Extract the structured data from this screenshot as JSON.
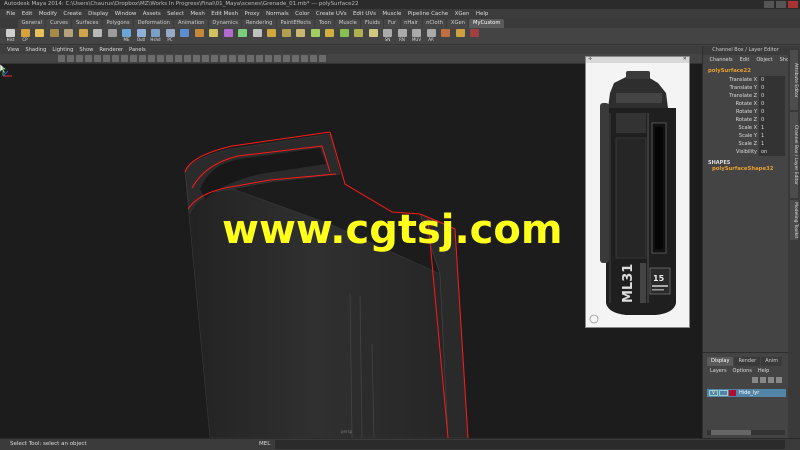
{
  "window": {
    "title": "Autodesk Maya 2014: C:\\Users\\Chaurus\\Dropbox\\MZ\\Works In Progress\\Final\\01_Maya\\scenes\\Grenade_01.mb* --- polySurface22"
  },
  "menu": [
    "File",
    "Edit",
    "Modify",
    "Create",
    "Display",
    "Window",
    "Assets",
    "Select",
    "Mesh",
    "Edit Mesh",
    "Proxy",
    "Normals",
    "Color",
    "Create UVs",
    "Edit UVs",
    "Muscle",
    "Pipeline Cache",
    "XGen",
    "Help"
  ],
  "shelf_tabs": {
    "items": [
      "General",
      "Curves",
      "Surfaces",
      "Polygons",
      "Deformation",
      "Animation",
      "Dynamics",
      "Rendering",
      "PaintEffects",
      "Toon",
      "Muscle",
      "Fluids",
      "Fur",
      "nHair",
      "nCloth",
      "XGen",
      "MyCustom"
    ],
    "active": "MyCustom"
  },
  "shelf_buttons": [
    {
      "label": "Hist",
      "color": "#cfcfcf"
    },
    {
      "label": "CP",
      "color": "#d7a23a"
    },
    {
      "label": "",
      "color": "#e8c05a"
    },
    {
      "label": "",
      "color": "#a58a4a"
    },
    {
      "label": "",
      "color": "#b5a27a"
    },
    {
      "label": "",
      "color": "#cfa64a"
    },
    {
      "label": "",
      "color": "#b8b8b8"
    },
    {
      "label": "",
      "color": "#9c9c9c"
    },
    {
      "label": "ME",
      "color": "#6aa6d8"
    },
    {
      "label": "Outl",
      "color": "#8fb0d8"
    },
    {
      "label": "Hshd",
      "color": "#7aa0c8"
    },
    {
      "label": "PC",
      "color": "#9aa8c8"
    },
    {
      "label": "",
      "color": "#5a8ed0"
    },
    {
      "label": "",
      "color": "#c48a3a"
    },
    {
      "label": "",
      "color": "#d0c060"
    },
    {
      "label": "",
      "color": "#b06ad0"
    },
    {
      "label": "",
      "color": "#7ad07a"
    },
    {
      "label": "",
      "color": "#c0c0c0"
    },
    {
      "label": "",
      "color": "#d0a840"
    },
    {
      "label": "",
      "color": "#b0a050"
    },
    {
      "label": "",
      "color": "#c8b870"
    },
    {
      "label": "",
      "color": "#a0d060"
    },
    {
      "label": "",
      "color": "#d0b040"
    },
    {
      "label": "",
      "color": "#88c050"
    },
    {
      "label": "",
      "color": "#b0b050"
    },
    {
      "label": "",
      "color": "#d0c880"
    },
    {
      "label": "SN",
      "color": "#aaaaaa"
    },
    {
      "label": "RN",
      "color": "#aaaaaa"
    },
    {
      "label": "MUV",
      "color": "#aaaaaa"
    },
    {
      "label": "AR",
      "color": "#aaaaaa"
    },
    {
      "label": "",
      "color": "#c07040"
    },
    {
      "label": "",
      "color": "#d0a040"
    },
    {
      "label": "",
      "color": "#a04040"
    }
  ],
  "panel_menu": [
    "View",
    "Shading",
    "Lighting",
    "Show",
    "Renderer",
    "Panels"
  ],
  "viewport": {
    "watermark": "www.cgtsj.com",
    "camera_label": "persp"
  },
  "channel_box": {
    "title": "Channel Box / Layer Editor",
    "menu": [
      "Channels",
      "Edit",
      "Object",
      "Show"
    ],
    "object_name": "polySurface22",
    "attributes": [
      {
        "name": "Translate X",
        "value": "0"
      },
      {
        "name": "Translate Y",
        "value": "0"
      },
      {
        "name": "Translate Z",
        "value": "0"
      },
      {
        "name": "Rotate X",
        "value": "0"
      },
      {
        "name": "Rotate Y",
        "value": "0"
      },
      {
        "name": "Rotate Z",
        "value": "0"
      },
      {
        "name": "Scale X",
        "value": "1"
      },
      {
        "name": "Scale Y",
        "value": "1"
      },
      {
        "name": "Scale Z",
        "value": "1"
      },
      {
        "name": "Visibility",
        "value": "on"
      }
    ],
    "shapes_header": "SHAPES",
    "shape_name": "polySurfaceShape32"
  },
  "side_tabs": [
    "Attribute Editor",
    "Channel Box / Layer Editor",
    "Modeling Toolkit"
  ],
  "layer_editor": {
    "tabs": [
      "Display",
      "Render",
      "Anim"
    ],
    "active_tab": "Display",
    "menu": [
      "Layers",
      "Options",
      "Help"
    ],
    "layer": {
      "visible": "V",
      "name": "Hide_lyr",
      "color": "#b01030"
    }
  },
  "help_line": {
    "text": "Select Tool: select an object",
    "mel_label": "MEL"
  },
  "reference_image": {
    "model_text": "ML31",
    "badge_text": "15"
  },
  "colors": {
    "accent_object": "#e8a030",
    "selection_edge": "#ff1a1a",
    "watermark": "#ffff1a"
  }
}
